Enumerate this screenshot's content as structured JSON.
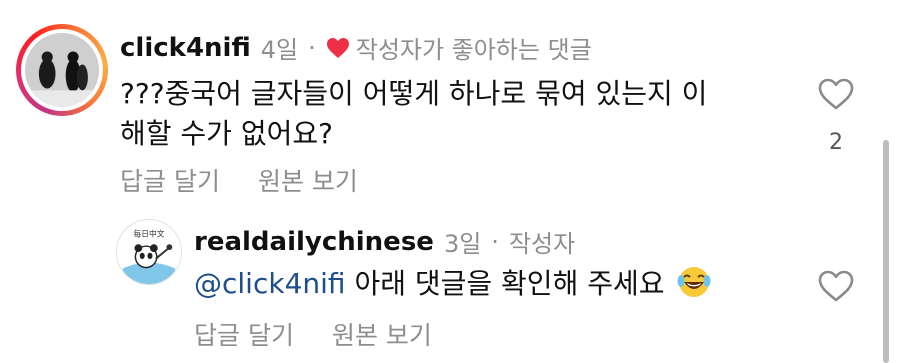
{
  "comment": {
    "username": "click4nifi",
    "time": "4일",
    "separator": "·",
    "liked_by_author": "작성자가 좋아하는 댓글",
    "text_line1": "???중국어 글자들이 어떻게 하나로 묶여 있는지 이",
    "text_line2": "해할 수가 없어요?",
    "like_count": "2",
    "reply_label": "답글 달기",
    "view_original_label": "원본 보기"
  },
  "reply": {
    "username": "realdailychinese",
    "time": "3일",
    "separator": "·",
    "author_badge": "작성자",
    "mention": "@click4nifi",
    "text": " 아래 댓글을 확인해 주세요 ",
    "emoji": "laughing-tears-emoji",
    "avatar_logo_text": "每日中文",
    "reply_label": "답글 달기",
    "view_original_label": "원본 보기"
  },
  "colors": {
    "heart_red": "#ed2f45",
    "meta_gray": "#8e8e8e",
    "mention_blue": "#1f4e8c"
  }
}
